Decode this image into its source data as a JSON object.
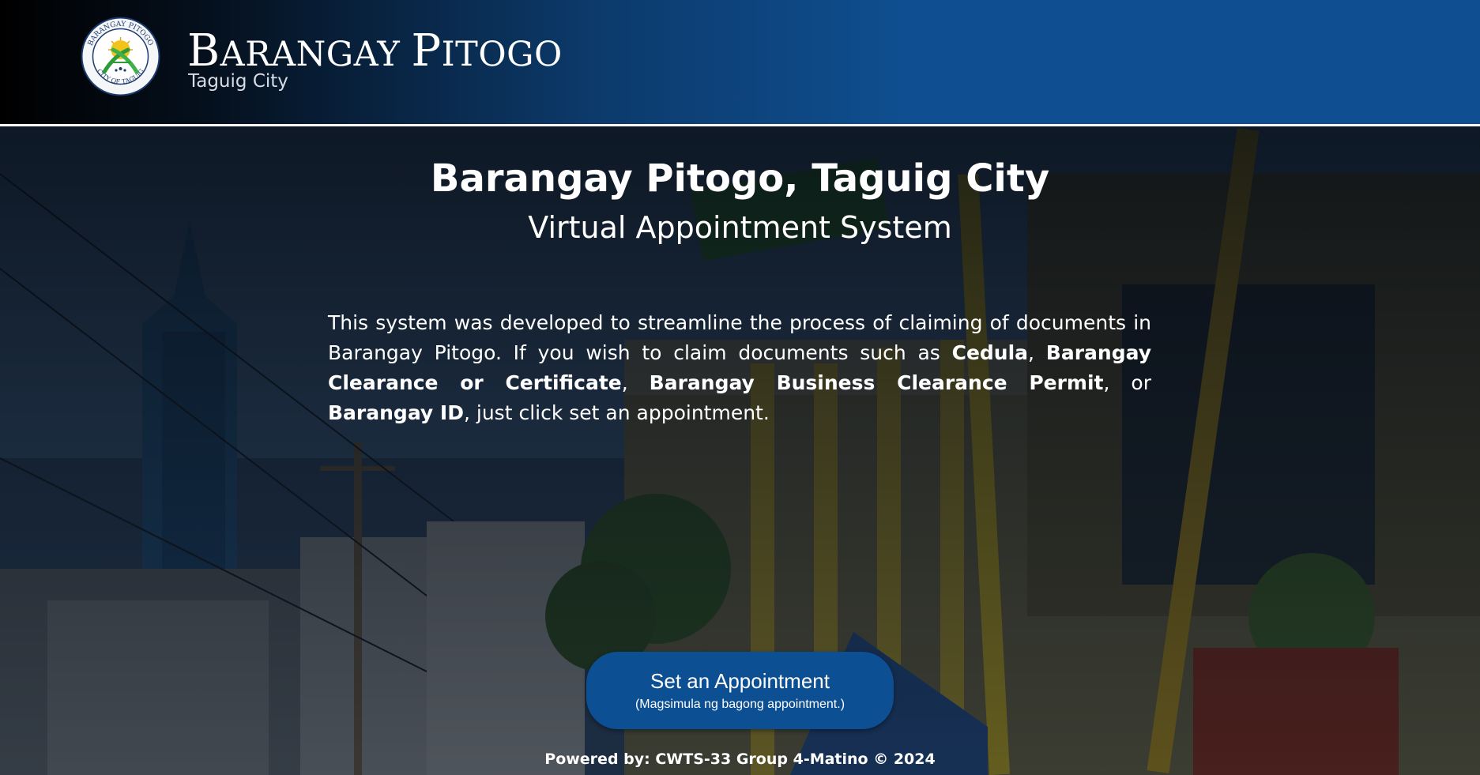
{
  "header": {
    "brand_title": "Barangay Pitogo",
    "brand_title_parts": {
      "b1": "B",
      "b2": "ARANGAY ",
      "p1": "P",
      "p2": "ITOGO"
    },
    "brand_subtitle": "Taguig City",
    "seal_icon": "barangay-seal",
    "seal_text_top": "BARANGAY PITOGO",
    "seal_text_bottom": "CITY OF TAGUIG"
  },
  "hero": {
    "title": "Barangay Pitogo, Taguig City",
    "subtitle": "Virtual Appointment System",
    "description": {
      "t1": "This system was developed to streamline the process of claiming of documents in Barangay Pitogo. If you wish to claim documents such as ",
      "b1": "Cedula",
      "t2": ", ",
      "b2": "Barangay Clearance or Certificate",
      "t3": ", ",
      "b3": "Barangay Business Clearance Permit",
      "t4": ", or ",
      "b4": "Barangay ID",
      "t5": ", just click set an appointment."
    },
    "background_image": "street-building-photo"
  },
  "cta": {
    "label": "Set an Appointment",
    "sublabel": "(Magsimula ng bagong appointment.)"
  },
  "footer": {
    "text": "Powered by: CWTS-33 Group 4-Matino © 2024"
  },
  "colors": {
    "header_blue": "#0f4f91",
    "button_blue": "#0c4f93",
    "text": "#ffffff"
  }
}
